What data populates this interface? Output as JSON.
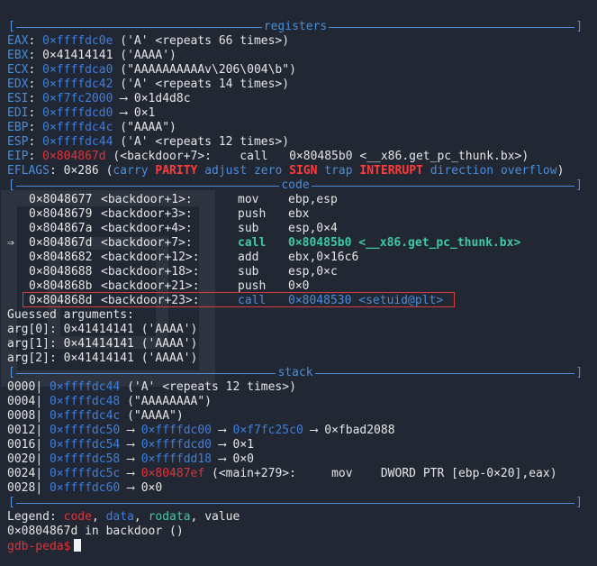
{
  "sections": {
    "registers": "registers",
    "code": "code",
    "stack": "stack"
  },
  "registers": [
    {
      "name": "EAX",
      "value": "0×ffffdc0e",
      "value_color": "blue",
      "rest": " ('A' <repeats 66 times>)"
    },
    {
      "name": "EBX",
      "value": "0×41414141",
      "value_color": "plain",
      "rest": " ('AAAA')"
    },
    {
      "name": "ECX",
      "value": "0×ffffdca0",
      "value_color": "blue",
      "rest": " (\"AAAAAAAAAAv\\206\\004\\b\")"
    },
    {
      "name": "EDX",
      "value": "0×ffffdc42",
      "value_color": "blue",
      "rest": " ('A' <repeats 14 times>)"
    },
    {
      "name": "ESI",
      "value": "0×f7fc2000",
      "value_color": "blue",
      "rest": " ⟶ 0×1d4d8c"
    },
    {
      "name": "EDI",
      "value": "0×ffffdcd0",
      "value_color": "blue",
      "rest": " ⟶ 0×1"
    },
    {
      "name": "EBP",
      "value": "0×ffffdc4c",
      "value_color": "blue",
      "rest": " (\"AAAA\")"
    },
    {
      "name": "ESP",
      "value": "0×ffffdc44",
      "value_color": "blue",
      "rest": " ('A' <repeats 12 times>)"
    },
    {
      "name": "EIP",
      "value": "0×804867d",
      "value_color": "red",
      "rest": " (<backdoor+7>:    call   0×80485b0 <__x86.get_pc_thunk.bx>)"
    }
  ],
  "eflags": {
    "label": "EFLAGS",
    "value": "0×286",
    "flags": [
      {
        "text": "carry",
        "set": false
      },
      {
        "text": "PARITY",
        "set": true
      },
      {
        "text": "adjust",
        "set": false
      },
      {
        "text": "zero",
        "set": false
      },
      {
        "text": "SIGN",
        "set": true
      },
      {
        "text": "trap",
        "set": false
      },
      {
        "text": "INTERRUPT",
        "set": true
      },
      {
        "text": "direction",
        "set": false
      },
      {
        "text": "overflow",
        "set": false
      }
    ]
  },
  "code": [
    {
      "marker": "",
      "addr": "0×8048677",
      "sym": "<backdoor+1>:",
      "op": "mov",
      "args": "ebp,esp",
      "style": "normal"
    },
    {
      "marker": "",
      "addr": "0×8048679",
      "sym": "<backdoor+3>:",
      "op": "push",
      "args": "ebx",
      "style": "normal"
    },
    {
      "marker": "",
      "addr": "0×804867a",
      "sym": "<backdoor+4>:",
      "op": "sub",
      "args": "esp,0×4",
      "style": "normal"
    },
    {
      "marker": "⇒",
      "addr": "0×804867d",
      "sym": "<backdoor+7>:",
      "op": "call",
      "args": "0×80485b0 <__x86.get_pc_thunk.bx>",
      "style": "current"
    },
    {
      "marker": "",
      "addr": "0×8048682",
      "sym": "<backdoor+12>:",
      "op": "add",
      "args": "ebx,0×16c6",
      "style": "normal"
    },
    {
      "marker": "",
      "addr": "0×8048688",
      "sym": "<backdoor+18>:",
      "op": "sub",
      "args": "esp,0×c",
      "style": "normal"
    },
    {
      "marker": "",
      "addr": "0×804868b",
      "sym": "<backdoor+21>:",
      "op": "push",
      "args": "0×0",
      "style": "normal"
    },
    {
      "marker": "",
      "addr": "0×804868d",
      "sym": "<backdoor+23>:",
      "op": "call",
      "args": "0×8048530 <setuid@plt>",
      "style": "highlighted"
    }
  ],
  "guessed": {
    "title": "Guessed arguments:",
    "args": [
      "arg[0]: 0×41414141 ('AAAA')",
      "arg[1]: 0×41414141 ('AAAA')",
      "arg[2]: 0×41414141 ('AAAA')"
    ]
  },
  "stack": [
    {
      "offset": "0000",
      "addr": "0×ffffdc44",
      "rest": " ('A' <repeats 12 times>)",
      "chain": []
    },
    {
      "offset": "0004",
      "addr": "0×ffffdc48",
      "rest": " (\"AAAAAAAA\")",
      "chain": []
    },
    {
      "offset": "0008",
      "addr": "0×ffffdc4c",
      "rest": " (\"AAAA\")",
      "chain": []
    },
    {
      "offset": "0012",
      "addr": "0×ffffdc50",
      "rest": "",
      "chain": [
        {
          "v": "0×ffffdc00",
          "c": "blue"
        },
        {
          "v": "0×f7fc25c0",
          "c": "blue"
        },
        {
          "v": "0×fbad2088",
          "c": "plain"
        }
      ]
    },
    {
      "offset": "0016",
      "addr": "0×ffffdc54",
      "rest": "",
      "chain": [
        {
          "v": "0×ffffdcd0",
          "c": "blue"
        },
        {
          "v": "0×1",
          "c": "plain"
        }
      ]
    },
    {
      "offset": "0020",
      "addr": "0×ffffdc58",
      "rest": "",
      "chain": [
        {
          "v": "0×ffffdd18",
          "c": "blue"
        },
        {
          "v": "0×0",
          "c": "plain"
        }
      ]
    },
    {
      "offset": "0024",
      "addr": "0×ffffdc5c",
      "rest": " (<main+279>:     mov    DWORD PTR [ebp-0×20],eax)",
      "chain": [
        {
          "v": "0×80487ef",
          "c": "red"
        }
      ]
    },
    {
      "offset": "0028",
      "addr": "0×ffffdc60",
      "rest": "",
      "chain": [
        {
          "v": "0×0",
          "c": "plain"
        }
      ]
    }
  ],
  "legend": {
    "prefix": "Legend: ",
    "code": "code",
    "data": "data",
    "rodata": "rodata",
    "value": "value"
  },
  "location": "0×0804867d in backdoor ()",
  "prompt": "gdb-peda$",
  "colors": {
    "background": "#212733",
    "separator": "#4a8dd9",
    "code": "#e0333a",
    "data": "#3d7fe0",
    "rodata": "#3ec9a7",
    "highlight_box": "#d73b3b"
  }
}
